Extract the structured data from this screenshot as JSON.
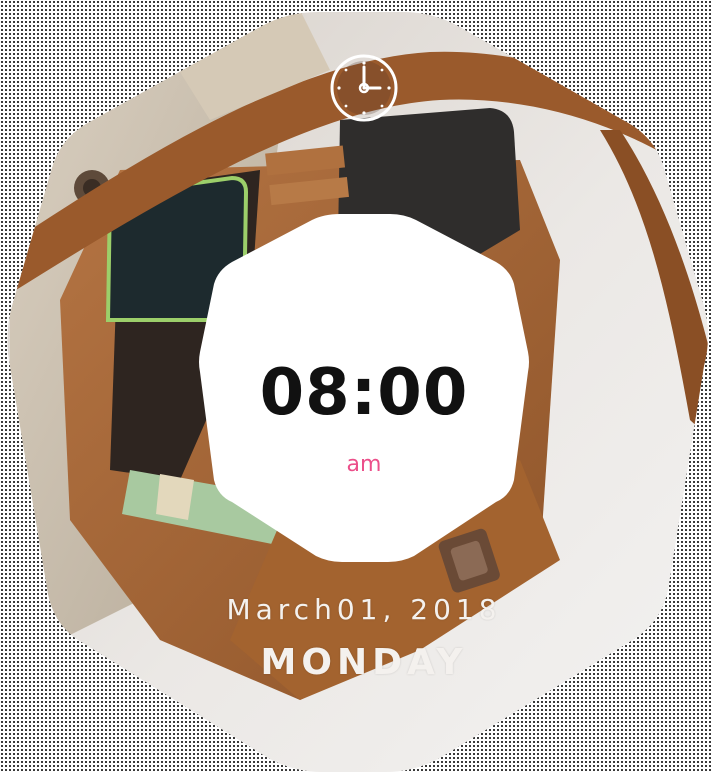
{
  "clock": {
    "time": "08:00",
    "period": "am",
    "date": "March01, 2018",
    "day": "MONDAY"
  },
  "icons": {
    "top": "clock-icon"
  },
  "colors": {
    "period_accent": "#ec4f8a",
    "card_background": "#ffffff",
    "leather_brown": "#a8693a",
    "background_dots": "#1a1a1a"
  }
}
